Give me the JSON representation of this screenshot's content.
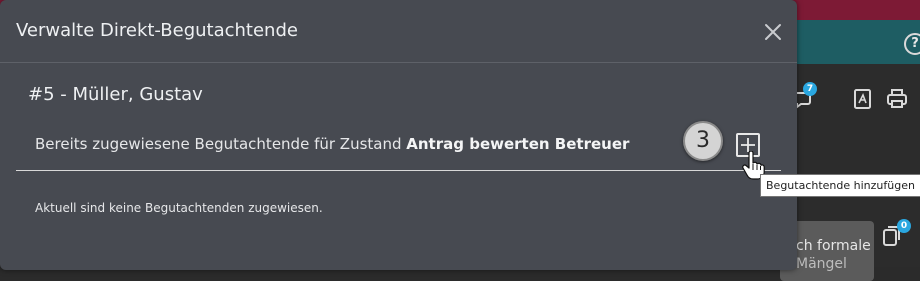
{
  "modal": {
    "title": "Verwalte Direkt-Begutachtende",
    "person_name": "#5 - Müller, Gustav",
    "assigned_label_prefix": "Bereits zugewiesene Begutachtende für Zustand ",
    "assigned_state": "Antrag bewerten Betreuer",
    "step_number": "3",
    "add_tooltip": "Begutachtende hinzufügen",
    "empty_message": "Aktuell sind keine Begutachtenden zugewiesen.",
    "close_icon": "close-icon",
    "add_icon": "plus-icon"
  },
  "background": {
    "help_icon_text": "?",
    "comments_badge": "7",
    "doc_badge": "0",
    "card_line1": "ch formale",
    "card_line2": "Mängel",
    "colors": {
      "top_bar": "#7d1a35",
      "teal_bar": "#1e5d63",
      "modal_bg": "#474a51",
      "badge_blue": "#2aa7e0"
    }
  }
}
